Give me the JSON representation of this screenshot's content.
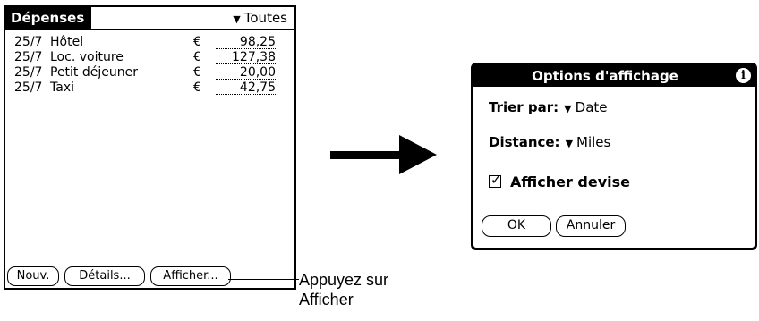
{
  "expense_screen": {
    "title": "Dépenses",
    "category": "Toutes",
    "rows": [
      {
        "date": "25/7",
        "desc": "Hôtel",
        "currency": "€",
        "amount": "98,25"
      },
      {
        "date": "25/7",
        "desc": "Loc. voiture",
        "currency": "€",
        "amount": "127,38"
      },
      {
        "date": "25/7",
        "desc": "Petit déjeuner",
        "currency": "€",
        "amount": "20,00"
      },
      {
        "date": "25/7",
        "desc": "Taxi",
        "currency": "€",
        "amount": "42,75"
      }
    ],
    "buttons": {
      "new": "Nouv.",
      "details": "Détails...",
      "show": "Afficher..."
    }
  },
  "callout": {
    "line1": "Appuyez sur",
    "line2": "Afficher"
  },
  "options_dialog": {
    "title": "Options d'affichage",
    "info_icon": "i",
    "sort_label": "Trier par:",
    "sort_value": "Date",
    "distance_label": "Distance:",
    "distance_value": "Miles",
    "show_currency_label": "Afficher devise",
    "show_currency_checked": true,
    "ok_label": "OK",
    "cancel_label": "Annuler"
  },
  "icons": {
    "dropdown": "triangle-down-icon",
    "arrow": "right-arrow-icon",
    "info": "info-icon"
  }
}
